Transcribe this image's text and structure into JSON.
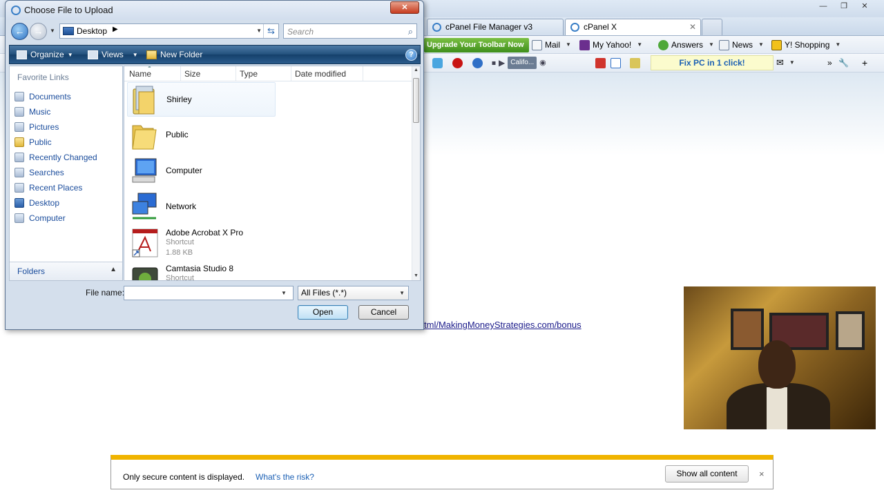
{
  "browser": {
    "tabs": [
      {
        "label": "cPanel File Manager v3",
        "active": false
      },
      {
        "label": "cPanel X",
        "active": true
      }
    ],
    "window_controls": [
      "minimize",
      "maximize",
      "close"
    ],
    "right_icons": [
      "home-icon",
      "star-icon",
      "gear-icon"
    ],
    "toolbar1": {
      "upgrade_label": "Upgrade Your Toolbar Now",
      "items": [
        {
          "label": "Mail",
          "icon": "mail-icon"
        },
        {
          "label": "My Yahoo!",
          "icon": "my-yahoo-icon"
        },
        {
          "label": "Answers",
          "icon": "answers-icon"
        },
        {
          "label": "News",
          "icon": "news-icon"
        },
        {
          "label": "Y! Shopping",
          "icon": "shopping-icon"
        }
      ]
    },
    "toolbar2": {
      "media_label": "Califo...",
      "fix_pc_label": "Fix PC in 1 click!"
    },
    "page": {
      "link_text": "tml/MakingMoneyStrategies.com/bonus"
    },
    "infobar": {
      "message": "Only secure content is displayed.",
      "link": "What's the risk?",
      "button": "Show all content",
      "close": "×"
    }
  },
  "dialog": {
    "title": "Choose File to Upload",
    "close_label": "✕",
    "address": "Desktop",
    "search_placeholder": "Search",
    "commands": {
      "organize": "Organize",
      "views": "Views",
      "new_folder": "New Folder"
    },
    "favorite_links_heading": "Favorite Links",
    "favorite_links": [
      {
        "label": "Documents",
        "icon": "documents-icon"
      },
      {
        "label": "Music",
        "icon": "music-icon"
      },
      {
        "label": "Pictures",
        "icon": "pictures-icon"
      },
      {
        "label": "Public",
        "icon": "folder-icon"
      },
      {
        "label": "Recently Changed",
        "icon": "recently-changed-icon"
      },
      {
        "label": "Searches",
        "icon": "searches-icon"
      },
      {
        "label": "Recent Places",
        "icon": "recent-places-icon"
      },
      {
        "label": "Desktop",
        "icon": "desktop-icon"
      },
      {
        "label": "Computer",
        "icon": "computer-icon"
      }
    ],
    "folders_label": "Folders",
    "columns": [
      "Name",
      "Size",
      "Type",
      "Date modified"
    ],
    "files": [
      {
        "name": "Shirley",
        "icon": "user-folder-icon"
      },
      {
        "name": "Public",
        "icon": "folder-icon"
      },
      {
        "name": "Computer",
        "icon": "computer-icon"
      },
      {
        "name": "Network",
        "icon": "network-icon"
      },
      {
        "name": "Adobe Acrobat X Pro",
        "icon": "acrobat-icon",
        "type": "Shortcut",
        "size": "1.88 KB"
      },
      {
        "name": "Camtasia Studio 8",
        "icon": "camtasia-icon",
        "type": "Shortcut"
      }
    ],
    "file_name_label": "File name:",
    "file_name_value": "",
    "file_type_filter": "All Files (*.*)",
    "open_label": "Open",
    "cancel_label": "Cancel"
  }
}
